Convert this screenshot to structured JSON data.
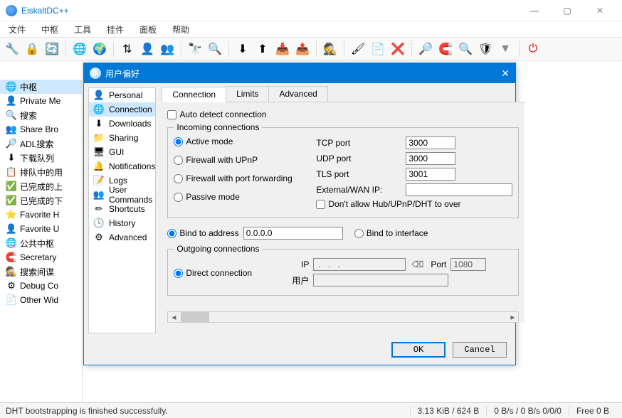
{
  "app": {
    "title": "EiskaltDC++"
  },
  "menu": [
    "文件",
    "中枢",
    "工具",
    "挂件",
    "面板",
    "帮助"
  ],
  "sidebar": {
    "items": [
      {
        "icon": "🌐",
        "label": "中枢"
      },
      {
        "icon": "👤",
        "label": "Private Me"
      },
      {
        "icon": "🔍",
        "label": "搜索"
      },
      {
        "icon": "👥",
        "label": "Share Bro"
      },
      {
        "icon": "🔎",
        "label": "ADL搜索"
      },
      {
        "icon": "⬇",
        "label": "下载队列"
      },
      {
        "icon": "📋",
        "label": "排队中的用"
      },
      {
        "icon": "✅",
        "label": "已完成的上"
      },
      {
        "icon": "✅",
        "label": "已完成的下"
      },
      {
        "icon": "⭐",
        "label": "Favorite H"
      },
      {
        "icon": "👤",
        "label": "Favorite U"
      },
      {
        "icon": "🌐",
        "label": "公共中枢"
      },
      {
        "icon": "🧲",
        "label": "Secretary"
      },
      {
        "icon": "🕵",
        "label": "搜索间谍"
      },
      {
        "icon": "⚙",
        "label": "Debug Co"
      },
      {
        "icon": "📄",
        "label": "Other Wid"
      }
    ]
  },
  "dialog": {
    "title": "用户偏好",
    "nav": [
      {
        "icon": "👤",
        "label": "Personal"
      },
      {
        "icon": "🌐",
        "label": "Connection"
      },
      {
        "icon": "⬇",
        "label": "Downloads"
      },
      {
        "icon": "📁",
        "label": "Sharing"
      },
      {
        "icon": "🖥",
        "label": "GUI"
      },
      {
        "icon": "🔔",
        "label": "Notifications"
      },
      {
        "icon": "📝",
        "label": "Logs"
      },
      {
        "icon": "👥",
        "label": "User Commands"
      },
      {
        "icon": "✏",
        "label": "Shortcuts"
      },
      {
        "icon": "🕓",
        "label": "History"
      },
      {
        "icon": "⚙",
        "label": "Advanced"
      }
    ],
    "tabs": [
      "Connection",
      "Limits",
      "Advanced"
    ],
    "conn": {
      "auto_detect": "Auto detect connection",
      "incoming_legend": "Incoming connections",
      "modes": {
        "active": "Active mode",
        "upnp": "Firewall with UPnP",
        "pfwd": "Firewall with port forwarding",
        "passive": "Passive mode"
      },
      "tcp_label": "TCP port",
      "tcp": "3000",
      "udp_label": "UDP port",
      "udp": "3000",
      "tls_label": "TLS port",
      "tls": "3001",
      "wan_label": "External/WAN IP:",
      "wan": "",
      "dont_allow": "Don't allow Hub/UPnP/DHT to over",
      "bind_addr_label": "Bind to address",
      "bind_addr": "0.0.0.0",
      "bind_if_label": "Bind to interface",
      "outgoing_legend": "Outgoing connections",
      "direct": "Direct connection",
      "ip_label": "IP",
      "ip": " .   .   .   ",
      "port_label": "Port",
      "port": "1080",
      "user_label": "用户",
      "user": ""
    },
    "ok": "OK",
    "cancel": "Cancel"
  },
  "status": {
    "msg": "DHT bootstrapping is finished successfully.",
    "transfer": "3.13 KiB / 624 B",
    "speed": "0 B/s / 0 B/s 0/0/0",
    "free": "Free 0 B"
  }
}
